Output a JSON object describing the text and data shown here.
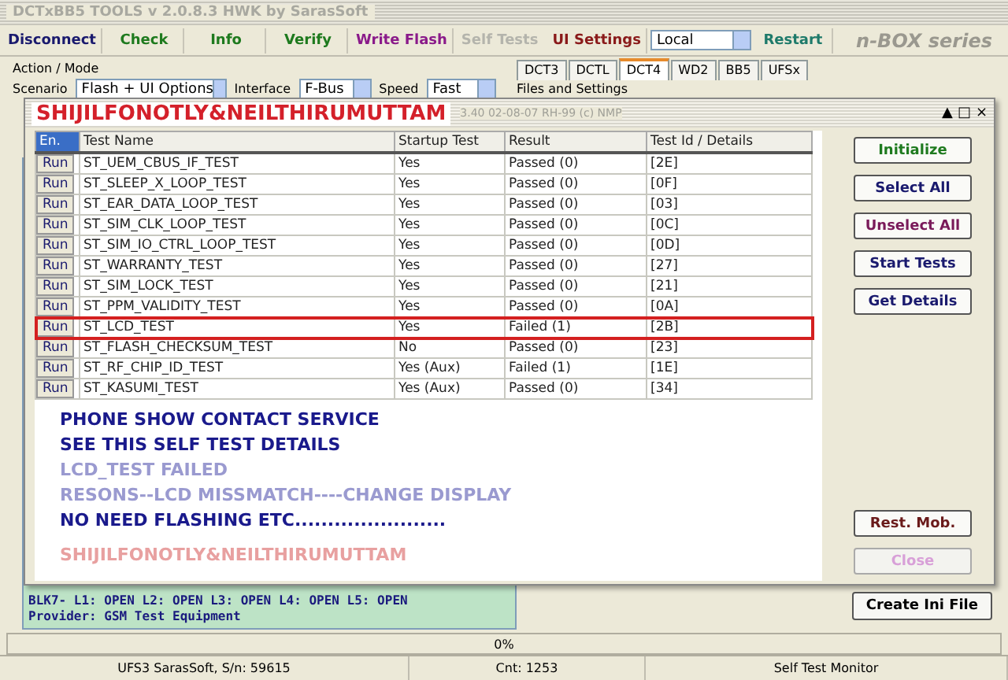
{
  "window": {
    "title": "DCTxBB5 TOOLS v 2.0.8.3 HWK by SarasSoft"
  },
  "toolbar": [
    {
      "label": "Disconnect",
      "color": "#1a1a6e",
      "disabled": false
    },
    {
      "label": "Check",
      "color": "#1e7a1e",
      "disabled": false
    },
    {
      "label": "Info",
      "color": "#1e7a1e",
      "disabled": false
    },
    {
      "label": "Verify",
      "color": "#1e7a1e",
      "disabled": false
    },
    {
      "label": "Write Flash",
      "color": "#8a1a8a",
      "disabled": false
    },
    {
      "label": "Self Tests",
      "color": "#b4b4ac",
      "disabled": true
    },
    {
      "label": "UI Settings",
      "color": "#8a1a1a",
      "disabled": false
    }
  ],
  "mode_select": {
    "value": "Local"
  },
  "restart": "Restart",
  "brand": "n-BOX series",
  "action_mode": {
    "title": "Action / Mode",
    "fields": [
      {
        "label": "Scenario",
        "value": "Flash + UI Options"
      },
      {
        "label": "Interface",
        "value": "F-Bus"
      },
      {
        "label": "Speed",
        "value": "Fast"
      }
    ]
  },
  "tabs": [
    {
      "label": "DCT3",
      "selected": false
    },
    {
      "label": "DCTL",
      "selected": false
    },
    {
      "label": "DCT4",
      "selected": true
    },
    {
      "label": "WD2",
      "selected": false
    },
    {
      "label": "BB5",
      "selected": false
    },
    {
      "label": "UFSx",
      "selected": false
    }
  ],
  "files_settings": "Files and Settings",
  "dialog": {
    "title": "SHIJILFONOTLY&NEILTHIRUMUTTAM",
    "subtitle": "3.40 02-08-07 RH-99 (c) NMP",
    "controls": [
      "▲",
      "□",
      "×"
    ],
    "columns": [
      "En.",
      "Test Name",
      "Startup Test",
      "Result",
      "Test Id / Details"
    ],
    "rows": [
      {
        "run": "Run",
        "name": "ST_UEM_CBUS_IF_TEST",
        "startup": "Yes",
        "result": "Passed (0)",
        "id": "[2E]",
        "highlighted": false
      },
      {
        "run": "Run",
        "name": "ST_SLEEP_X_LOOP_TEST",
        "startup": "Yes",
        "result": "Passed (0)",
        "id": "[0F]",
        "highlighted": false
      },
      {
        "run": "Run",
        "name": "ST_EAR_DATA_LOOP_TEST",
        "startup": "Yes",
        "result": "Passed (0)",
        "id": "[03]",
        "highlighted": false
      },
      {
        "run": "Run",
        "name": "ST_SIM_CLK_LOOP_TEST",
        "startup": "Yes",
        "result": "Passed (0)",
        "id": "[0C]",
        "highlighted": false
      },
      {
        "run": "Run",
        "name": "ST_SIM_IO_CTRL_LOOP_TEST",
        "startup": "Yes",
        "result": "Passed (0)",
        "id": "[0D]",
        "highlighted": false
      },
      {
        "run": "Run",
        "name": "ST_WARRANTY_TEST",
        "startup": "Yes",
        "result": "Passed (0)",
        "id": "[27]",
        "highlighted": false
      },
      {
        "run": "Run",
        "name": "ST_SIM_LOCK_TEST",
        "startup": "Yes",
        "result": "Passed (0)",
        "id": "[21]",
        "highlighted": false
      },
      {
        "run": "Run",
        "name": "ST_PPM_VALIDITY_TEST",
        "startup": "Yes",
        "result": "Passed (0)",
        "id": "[0A]",
        "highlighted": false
      },
      {
        "run": "Run",
        "name": "ST_LCD_TEST",
        "startup": "Yes",
        "result": "Failed (1)",
        "id": "[2B]",
        "highlighted": true
      },
      {
        "run": "Run",
        "name": "ST_FLASH_CHECKSUM_TEST",
        "startup": "No",
        "result": "Passed (0)",
        "id": "[23]",
        "highlighted": false
      },
      {
        "run": "Run",
        "name": "ST_RF_CHIP_ID_TEST",
        "startup": "Yes (Aux)",
        "result": "Failed (1)",
        "id": "[1E]",
        "highlighted": false
      },
      {
        "run": "Run",
        "name": "ST_KASUMI_TEST",
        "startup": "Yes (Aux)",
        "result": "Passed (0)",
        "id": "[34]",
        "highlighted": false
      }
    ],
    "buttons": [
      {
        "label": "Initialize",
        "color": "#1e7a1e",
        "disabled": false
      },
      {
        "label": "Select All",
        "color": "#1a1a6e",
        "disabled": false
      },
      {
        "label": "Unselect All",
        "color": "#7a1a5a",
        "disabled": false
      },
      {
        "label": "Start Tests",
        "color": "#1a1a6e",
        "disabled": false
      },
      {
        "label": "Get Details",
        "color": "#1a1a6e",
        "disabled": false
      }
    ],
    "message": [
      {
        "kind": "notice",
        "text": "PHONE SHOW CONTACT SERVICE"
      },
      {
        "kind": "notice",
        "text": "SEE THIS SELF TEST DETAILS"
      },
      {
        "kind": "faded",
        "text": "LCD_TEST FAILED"
      },
      {
        "kind": "faded",
        "text": "RESONS--LCD MISSMATCH----CHANGE DISPLAY"
      },
      {
        "kind": "notice",
        "text": "NO NEED FLASHING ETC......................."
      },
      {
        "kind": "signature",
        "text": "SHIJILFONOTLY&NEILTHIRUMUTTAM"
      }
    ],
    "bottom_buttons": [
      {
        "label": "Rest. Mob.",
        "color": "#6a1a1a",
        "disabled": false
      },
      {
        "label": "Close",
        "color": "#d8a0d8",
        "disabled": true
      }
    ]
  },
  "log": [
    "BLK7- L1: OPEN L2: OPEN L3: OPEN L4: OPEN L5: OPEN",
    "Provider: GSM Test Equipment"
  ],
  "create_ini": "Create Ini File",
  "progress": {
    "label": "0%",
    "level": 0
  },
  "status_bar": [
    "UFS3 SarasSoft, S/n: 59615",
    "Cnt: 1253",
    "Self Test Monitor"
  ]
}
